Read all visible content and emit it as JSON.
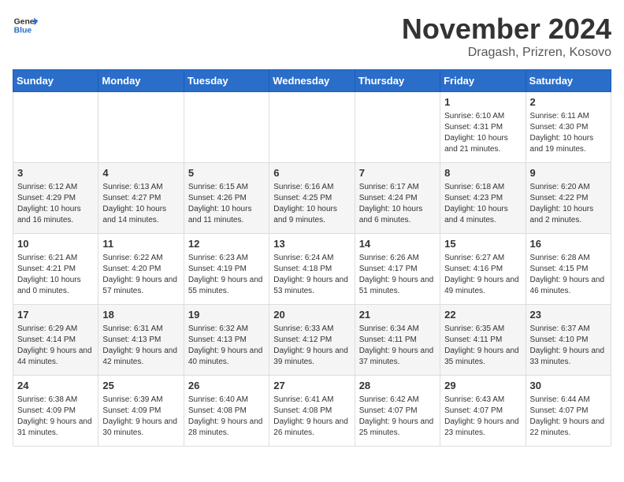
{
  "header": {
    "logo_general": "General",
    "logo_blue": "Blue",
    "month_title": "November 2024",
    "location": "Dragash, Prizren, Kosovo"
  },
  "days_of_week": [
    "Sunday",
    "Monday",
    "Tuesday",
    "Wednesday",
    "Thursday",
    "Friday",
    "Saturday"
  ],
  "weeks": [
    [
      {
        "day": "",
        "info": ""
      },
      {
        "day": "",
        "info": ""
      },
      {
        "day": "",
        "info": ""
      },
      {
        "day": "",
        "info": ""
      },
      {
        "day": "",
        "info": ""
      },
      {
        "day": "1",
        "info": "Sunrise: 6:10 AM\nSunset: 4:31 PM\nDaylight: 10 hours and 21 minutes."
      },
      {
        "day": "2",
        "info": "Sunrise: 6:11 AM\nSunset: 4:30 PM\nDaylight: 10 hours and 19 minutes."
      }
    ],
    [
      {
        "day": "3",
        "info": "Sunrise: 6:12 AM\nSunset: 4:29 PM\nDaylight: 10 hours and 16 minutes."
      },
      {
        "day": "4",
        "info": "Sunrise: 6:13 AM\nSunset: 4:27 PM\nDaylight: 10 hours and 14 minutes."
      },
      {
        "day": "5",
        "info": "Sunrise: 6:15 AM\nSunset: 4:26 PM\nDaylight: 10 hours and 11 minutes."
      },
      {
        "day": "6",
        "info": "Sunrise: 6:16 AM\nSunset: 4:25 PM\nDaylight: 10 hours and 9 minutes."
      },
      {
        "day": "7",
        "info": "Sunrise: 6:17 AM\nSunset: 4:24 PM\nDaylight: 10 hours and 6 minutes."
      },
      {
        "day": "8",
        "info": "Sunrise: 6:18 AM\nSunset: 4:23 PM\nDaylight: 10 hours and 4 minutes."
      },
      {
        "day": "9",
        "info": "Sunrise: 6:20 AM\nSunset: 4:22 PM\nDaylight: 10 hours and 2 minutes."
      }
    ],
    [
      {
        "day": "10",
        "info": "Sunrise: 6:21 AM\nSunset: 4:21 PM\nDaylight: 10 hours and 0 minutes."
      },
      {
        "day": "11",
        "info": "Sunrise: 6:22 AM\nSunset: 4:20 PM\nDaylight: 9 hours and 57 minutes."
      },
      {
        "day": "12",
        "info": "Sunrise: 6:23 AM\nSunset: 4:19 PM\nDaylight: 9 hours and 55 minutes."
      },
      {
        "day": "13",
        "info": "Sunrise: 6:24 AM\nSunset: 4:18 PM\nDaylight: 9 hours and 53 minutes."
      },
      {
        "day": "14",
        "info": "Sunrise: 6:26 AM\nSunset: 4:17 PM\nDaylight: 9 hours and 51 minutes."
      },
      {
        "day": "15",
        "info": "Sunrise: 6:27 AM\nSunset: 4:16 PM\nDaylight: 9 hours and 49 minutes."
      },
      {
        "day": "16",
        "info": "Sunrise: 6:28 AM\nSunset: 4:15 PM\nDaylight: 9 hours and 46 minutes."
      }
    ],
    [
      {
        "day": "17",
        "info": "Sunrise: 6:29 AM\nSunset: 4:14 PM\nDaylight: 9 hours and 44 minutes."
      },
      {
        "day": "18",
        "info": "Sunrise: 6:31 AM\nSunset: 4:13 PM\nDaylight: 9 hours and 42 minutes."
      },
      {
        "day": "19",
        "info": "Sunrise: 6:32 AM\nSunset: 4:13 PM\nDaylight: 9 hours and 40 minutes."
      },
      {
        "day": "20",
        "info": "Sunrise: 6:33 AM\nSunset: 4:12 PM\nDaylight: 9 hours and 39 minutes."
      },
      {
        "day": "21",
        "info": "Sunrise: 6:34 AM\nSunset: 4:11 PM\nDaylight: 9 hours and 37 minutes."
      },
      {
        "day": "22",
        "info": "Sunrise: 6:35 AM\nSunset: 4:11 PM\nDaylight: 9 hours and 35 minutes."
      },
      {
        "day": "23",
        "info": "Sunrise: 6:37 AM\nSunset: 4:10 PM\nDaylight: 9 hours and 33 minutes."
      }
    ],
    [
      {
        "day": "24",
        "info": "Sunrise: 6:38 AM\nSunset: 4:09 PM\nDaylight: 9 hours and 31 minutes."
      },
      {
        "day": "25",
        "info": "Sunrise: 6:39 AM\nSunset: 4:09 PM\nDaylight: 9 hours and 30 minutes."
      },
      {
        "day": "26",
        "info": "Sunrise: 6:40 AM\nSunset: 4:08 PM\nDaylight: 9 hours and 28 minutes."
      },
      {
        "day": "27",
        "info": "Sunrise: 6:41 AM\nSunset: 4:08 PM\nDaylight: 9 hours and 26 minutes."
      },
      {
        "day": "28",
        "info": "Sunrise: 6:42 AM\nSunset: 4:07 PM\nDaylight: 9 hours and 25 minutes."
      },
      {
        "day": "29",
        "info": "Sunrise: 6:43 AM\nSunset: 4:07 PM\nDaylight: 9 hours and 23 minutes."
      },
      {
        "day": "30",
        "info": "Sunrise: 6:44 AM\nSunset: 4:07 PM\nDaylight: 9 hours and 22 minutes."
      }
    ]
  ]
}
